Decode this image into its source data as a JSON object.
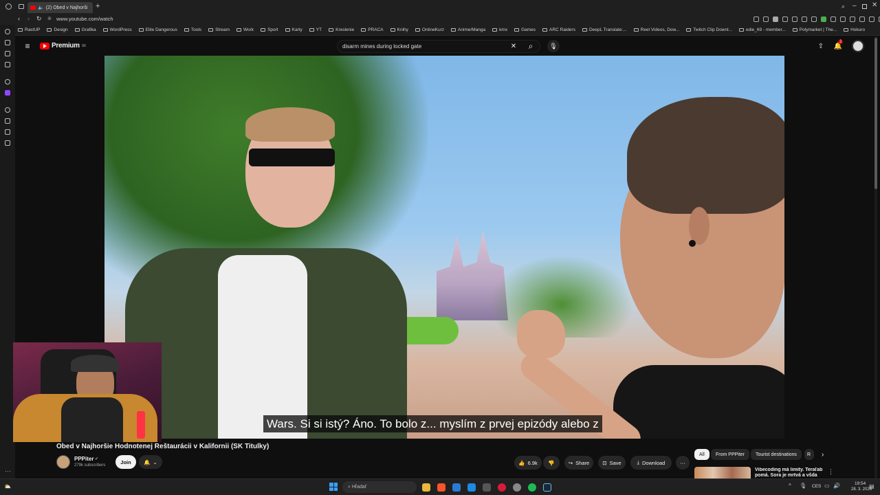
{
  "browser": {
    "tab_title": "(2) Obed v Najhorši",
    "url": "www.youtube.com/watch",
    "bookmarks": [
      "RastUP",
      "Design",
      "Grafika",
      "WordPress",
      "Elite Dangerous",
      "Tools",
      "Stream",
      "Work",
      "Sport",
      "Karty",
      "YT",
      "Kreslenie",
      "PRACA",
      "Knihy",
      "OnlineKurz",
      "Anime/Manga",
      "kmx",
      "Games",
      "ARC Raiders",
      "DeepL Translate:...",
      "Reel Videos, Dow...",
      "Twitch Clip Downl...",
      "edie_69 - member...",
      "Polymarket | The...",
      "Hokuro"
    ]
  },
  "youtube": {
    "logo": "Premium",
    "region": "SK",
    "search_value": "disarm mines during locked gate",
    "notification_count": "2",
    "subtitle": "Wars. Si si istý? Áno. To bolo z... myslím z prvej epizódy alebo z",
    "video_title": "Obed v Najhoršie Hodnotenej Reštaurácii v Kalifornii (SK Titulky)",
    "channel": {
      "name": "PPPiter",
      "subscribers": "279k subscribers",
      "join_label": "Join"
    },
    "actions": {
      "likes": "6.9k",
      "share": "Share",
      "save": "Save",
      "download": "Download"
    },
    "chips": [
      "All",
      "From PPPiter",
      "Tourist destinations",
      "R"
    ],
    "recommendation": "Vibecoding má limity. Teraľab pomá. Sora je mrtvá a všda"
  },
  "taskbar": {
    "search_placeholder": "Hľadať",
    "lang": "CES",
    "time": "19:54",
    "date": "28. 3. 2026"
  },
  "colors": {
    "accent": "#ff0000",
    "bg": "#0f0f0f",
    "chip": "#272727"
  }
}
